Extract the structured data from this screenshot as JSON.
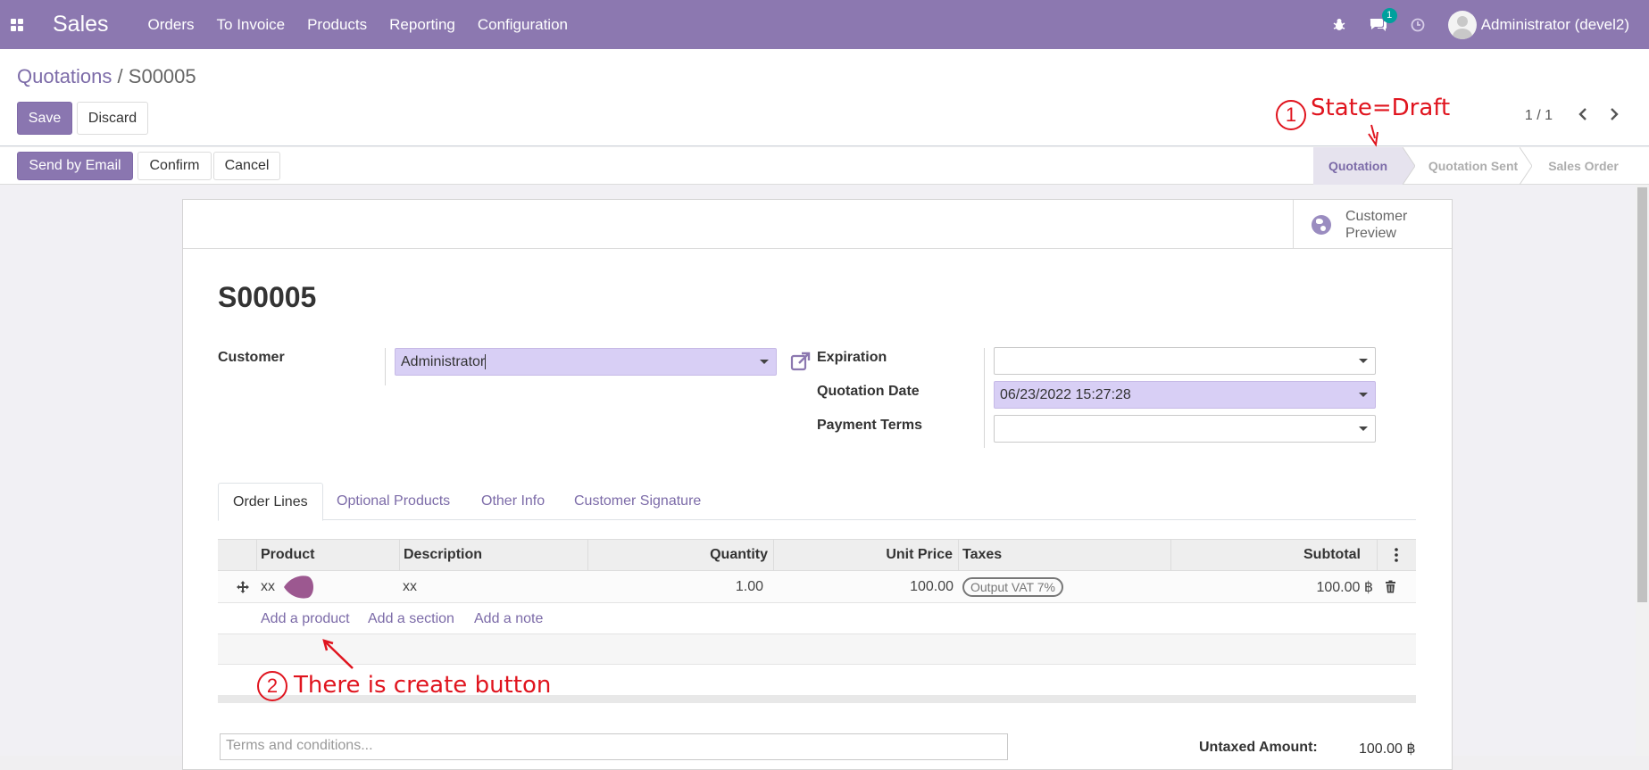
{
  "navbar": {
    "app_name": "Sales",
    "menu": [
      "Orders",
      "To Invoice",
      "Products",
      "Reporting",
      "Configuration"
    ],
    "message_count": "1",
    "user": "Administrator (devel2)"
  },
  "breadcrumb": {
    "parent": "Quotations",
    "separator": "/",
    "current": "S00005"
  },
  "actions": {
    "save": "Save",
    "discard": "Discard"
  },
  "pager": {
    "text": "1 / 1"
  },
  "workflow_buttons": {
    "send_email": "Send by Email",
    "confirm": "Confirm",
    "cancel": "Cancel"
  },
  "status_stages": {
    "quotation": "Quotation",
    "sent": "Quotation Sent",
    "sales_order": "Sales Order"
  },
  "smart_button": {
    "line1": "Customer",
    "line2": "Preview"
  },
  "record": {
    "name": "S00005",
    "customer_label": "Customer",
    "customer_value": "Administrator",
    "expiration_label": "Expiration",
    "expiration_value": "",
    "quotation_date_label": "Quotation Date",
    "quotation_date_value": "06/23/2022 15:27:28",
    "payment_terms_label": "Payment Terms",
    "payment_terms_value": ""
  },
  "tabs": [
    "Order Lines",
    "Optional Products",
    "Other Info",
    "Customer Signature"
  ],
  "order_lines": {
    "columns": {
      "product": "Product",
      "description": "Description",
      "quantity": "Quantity",
      "unit_price": "Unit Price",
      "taxes": "Taxes",
      "subtotal": "Subtotal"
    },
    "rows": [
      {
        "product": "xx",
        "description": "xx",
        "quantity": "1.00",
        "unit_price": "100.00",
        "taxes": "Output VAT 7%",
        "subtotal": "100.00 ฿"
      }
    ],
    "add_product": "Add a product",
    "add_section": "Add a section",
    "add_note": "Add a note"
  },
  "terms_placeholder": "Terms and conditions...",
  "totals": {
    "untaxed_label": "Untaxed Amount:",
    "untaxed_value": "100.00 ฿"
  },
  "annotations": {
    "one": {
      "number": "1",
      "text": "State=Draft"
    },
    "two": {
      "number": "2",
      "text": "There is create button"
    }
  },
  "colors": {
    "brand": "#8c78b0",
    "annotation": "#e0141e",
    "required_field": "#d8cff5"
  }
}
